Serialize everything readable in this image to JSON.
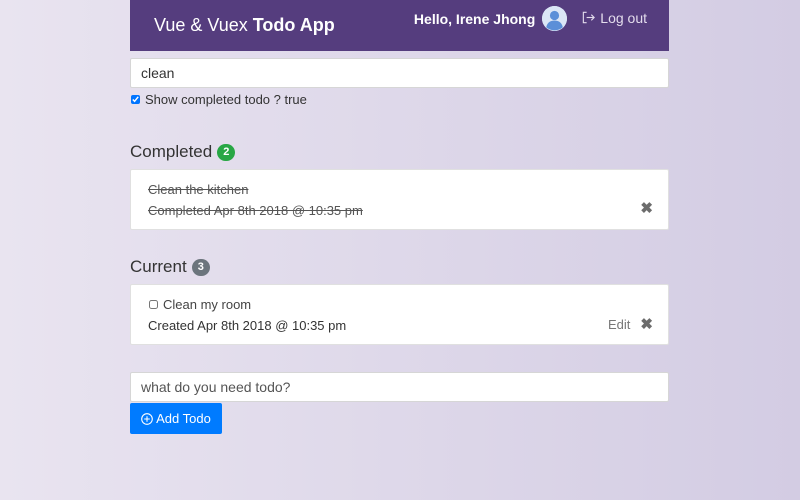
{
  "header": {
    "brand_prefix": "Vue & Vuex",
    "brand_strong": "Todo App",
    "greeting": "Hello, Irene Jhong",
    "logout_label": "Log out"
  },
  "filter": {
    "value": "clean",
    "placeholder": ""
  },
  "show_completed": {
    "label": "Show completed todo ? true",
    "checked": true
  },
  "completed": {
    "title": "Completed",
    "count": "2",
    "items": [
      {
        "text": "Clean the kitchen",
        "date": "Completed Apr 8th 2018 @ 10:35 pm"
      }
    ]
  },
  "current": {
    "title": "Current",
    "count": "3",
    "items": [
      {
        "text": "Clean my room",
        "date": "Created Apr 8th 2018 @ 10:35 pm",
        "edit_label": "Edit"
      }
    ]
  },
  "new_todo": {
    "placeholder": "what do you need todo?"
  },
  "add_button": {
    "label": "Add Todo"
  },
  "colors": {
    "navbar": "#553d7e",
    "completed_badge": "#28a745",
    "current_badge": "#6c757d",
    "primary": "#007bff"
  },
  "icons": {
    "avatar": "user-avatar-icon",
    "logout": "logout-icon",
    "remove": "close-icon",
    "add": "plus-circle-icon"
  }
}
